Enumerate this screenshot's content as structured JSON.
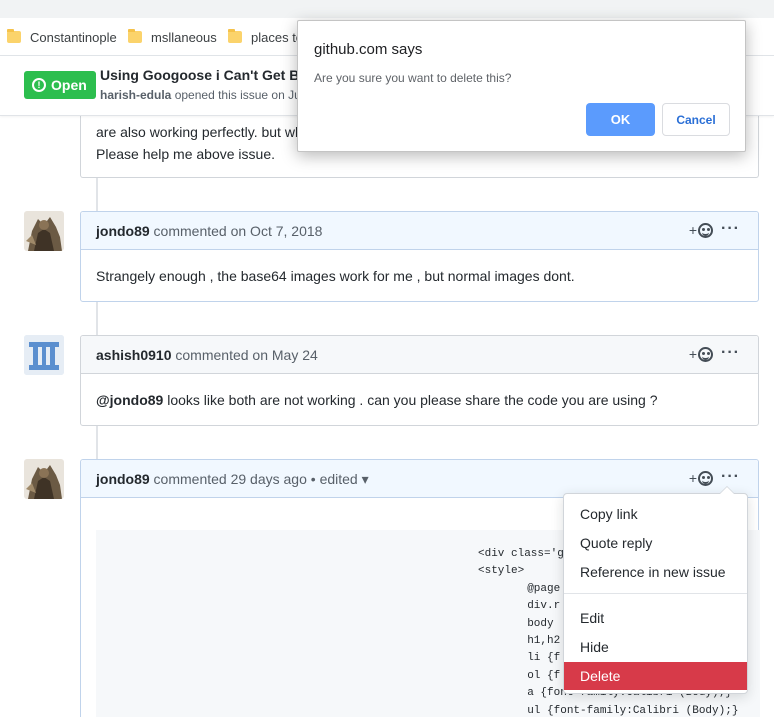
{
  "bookmarks": [
    {
      "label": "Constantinople",
      "icon": "folder-icon"
    },
    {
      "label": "msllaneous",
      "icon": "folder-icon"
    },
    {
      "label": "places to",
      "icon": "folder-icon"
    }
  ],
  "issue": {
    "state": "Open",
    "state_icon": "!",
    "title": "Using Googoose i Can't Get Bas",
    "author": "harish-edula",
    "meta_suffix": " opened this issue on Jun",
    "state_color": "#2cbe4e"
  },
  "issue_body_tail": {
    "line1": "are also working perfectly. but wh",
    "line2": "Please help me above issue."
  },
  "comments": [
    {
      "author": "jondo89",
      "meta": " commented on Oct 7, 2018",
      "body": "Strangely enough , the base64 images work for me , but normal images dont.",
      "react_label": "+",
      "more_label": "···"
    },
    {
      "author": "ashish0910",
      "meta": " commented on May 24",
      "body_mention": "@jondo89",
      "body": " looks like both are not working . can you please share the code you are using ?",
      "react_label": "+",
      "more_label": "···"
    },
    {
      "author": "jondo89",
      "meta": " commented 29 days ago",
      "edited": " • edited ▾",
      "react_label": "+",
      "more_label": "···",
      "code": [
        "<div class='g",
        "<style>",
        "       @page",
        "       div.r",
        "       body",
        "       h1,h2",
        "       li {f",
        "       ol {f",
        "       a {font-family:Calibri (Body);}",
        "       ul {font-family:Calibri (Body);}"
      ]
    }
  ],
  "menu": {
    "items": [
      "Copy link",
      "Quote reply",
      "Reference in new issue",
      "Edit",
      "Hide",
      "Delete"
    ]
  },
  "dialog": {
    "title": "github.com says",
    "message": "Are you sure you want to delete this?",
    "ok": "OK",
    "cancel": "Cancel"
  }
}
